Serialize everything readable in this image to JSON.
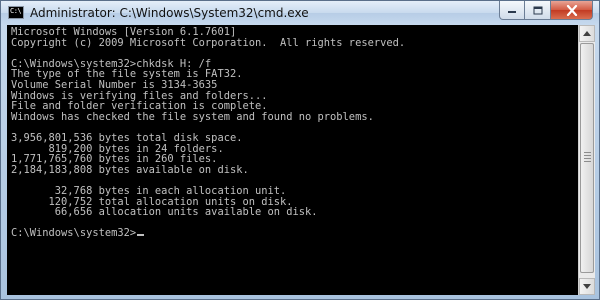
{
  "window": {
    "title": "Administrator: C:\\Windows\\System32\\cmd.exe",
    "icon_text": "C:\\",
    "icon": "cmd-icon",
    "minimize_icon": "minimize-icon",
    "maximize_icon": "maximize-icon",
    "close_icon": "close-icon",
    "close_color": "#c9452a"
  },
  "console": {
    "background": "#000000",
    "text_color": "#c0c0c0",
    "lines": [
      "Microsoft Windows [Version 6.1.7601]",
      "Copyright (c) 2009 Microsoft Corporation.  All rights reserved.",
      "",
      "C:\\Windows\\system32>chkdsk H: /f",
      "The type of the file system is FAT32.",
      "Volume Serial Number is 3134-3635",
      "Windows is verifying files and folders...",
      "File and folder verification is complete.",
      "Windows has checked the file system and found no problems.",
      "",
      "3,956,801,536 bytes total disk space.",
      "      819,200 bytes in 24 folders.",
      "1,771,765,760 bytes in 260 files.",
      "2,184,183,808 bytes available on disk.",
      "",
      "       32,768 bytes in each allocation unit.",
      "      120,752 total allocation units on disk.",
      "       66,656 allocation units available on disk.",
      "",
      "C:\\Windows\\system32>"
    ]
  },
  "scrollbar": {
    "up_icon": "scroll-up-arrow-icon",
    "down_icon": "scroll-down-arrow-icon"
  }
}
